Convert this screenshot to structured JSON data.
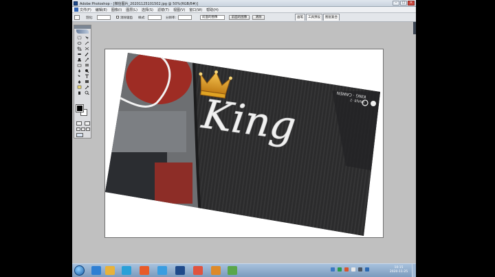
{
  "window": {
    "title": "Adobe Photoshop - [微信图片_20201125101502.jpg @ 50%(RGB/8#)]",
    "controls": [
      "–",
      "□",
      "×"
    ]
  },
  "menubar": {
    "items": [
      "文件(F)",
      "编辑(E)",
      "图像(I)",
      "图层(L)",
      "选择(S)",
      "滤镜(T)",
      "视图(V)",
      "窗口(W)",
      "帮助(H)"
    ]
  },
  "options": {
    "feather_label": "羽化:",
    "antialias_label": "消除锯齿",
    "style_label": "样式:",
    "resolution_label": "分辨率:",
    "size_dropdown": "前面的图像",
    "clear_button": "清除",
    "tabs": [
      "画笔",
      "工具预设",
      "图层复合"
    ]
  },
  "tools": {
    "icons": [
      "marquee-icon",
      "move-icon",
      "lasso-icon",
      "magic-wand-icon",
      "crop-icon",
      "slice-icon",
      "healing-icon",
      "brush-icon",
      "stamp-icon",
      "history-brush-icon",
      "eraser-icon",
      "gradient-icon",
      "blur-icon",
      "dodge-icon",
      "path-select-icon",
      "type-icon",
      "pen-icon",
      "shape-icon",
      "notes-icon",
      "eyedropper-icon",
      "hand-icon",
      "zoom-icon"
    ],
    "foreground": "#000000",
    "background": "#ffffff"
  },
  "image": {
    "embroidery_text": "King",
    "mirrored_text_line1": "KING · CAWEN",
    "mirrored_text_line2": "8NAJ8 ·2"
  },
  "colors": {
    "workspace": "#c0c0c0",
    "sweater": "#2a2a2b",
    "crown": "#e0a323",
    "embroidery": "#f1f1f1",
    "seat_red": "#9e2c24"
  },
  "taskbar": {
    "apps": [
      "ie-icon",
      "folder-icon",
      "qq-icon",
      "media-icon",
      "browser-icon",
      "photoshop-icon",
      "paint-icon",
      "camera-icon",
      "tool-icon"
    ],
    "time": "10:15",
    "date": "2020-11-25"
  }
}
